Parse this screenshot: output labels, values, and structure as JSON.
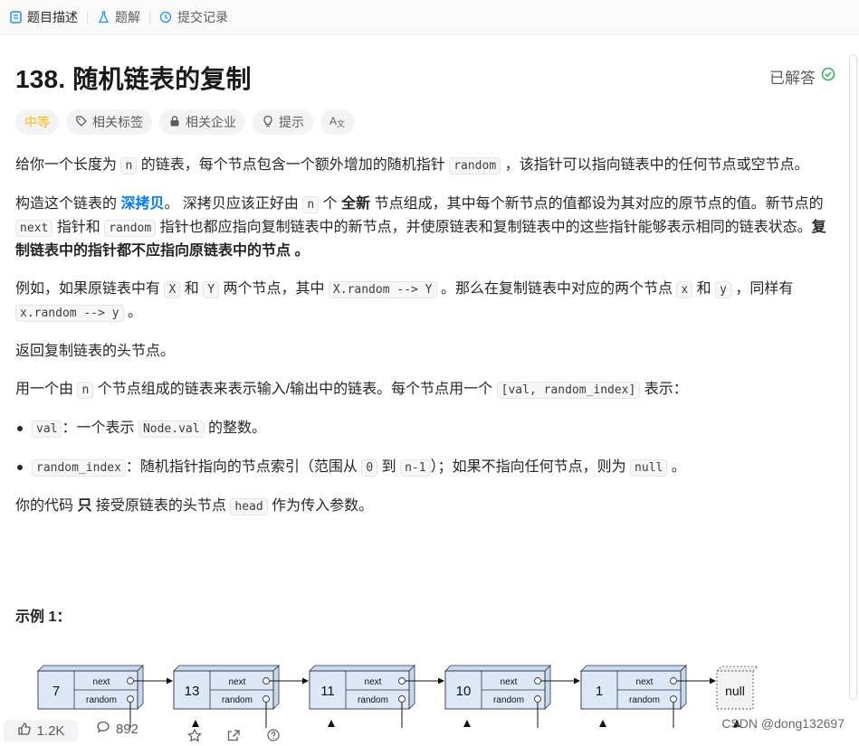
{
  "tabs": [
    {
      "label": "题目描述",
      "icon": "document-icon"
    },
    {
      "label": "题解",
      "icon": "flask-icon"
    },
    {
      "label": "提交记录",
      "icon": "clock-icon"
    }
  ],
  "problem": {
    "title": "138. 随机链表的复制",
    "status": "已解答"
  },
  "tags": {
    "difficulty": "中等",
    "related_tags": "相关标签",
    "related_companies": "相关企业",
    "hint": "提示",
    "translate": "A文"
  },
  "desc": {
    "p1_a": "给你一个长度为 ",
    "p1_code1": "n",
    "p1_b": " 的链表，每个节点包含一个额外增加的随机指针 ",
    "p1_code2": "random",
    "p1_c": " ，该指针可以指向链表中的任何节点或空节点。",
    "p2_a": "构造这个链表的 ",
    "p2_link": "深拷贝",
    "p2_b": "。 深拷贝应该正好由 ",
    "p2_code1": "n",
    "p2_c": " 个 ",
    "p2_bold1": "全新",
    "p2_d": " 节点组成，其中每个新节点的值都设为其对应的原节点的值。新节点的 ",
    "p2_code2": "next",
    "p2_e": " 指针和 ",
    "p2_code3": "random",
    "p2_f": " 指针也都应指向复制链表中的新节点，并使原链表和复制链表中的这些指针能够表示相同的链表状态。",
    "p2_bold2": "复制链表中的指针都不应指向原链表中的节点",
    "p2_g": " 。",
    "p3_a": "例如，如果原链表中有 ",
    "p3_code1": "X",
    "p3_b": " 和 ",
    "p3_code2": "Y",
    "p3_c": " 两个节点，其中 ",
    "p3_code3": "X.random --> Y",
    "p3_d": " 。那么在复制链表中对应的两个节点 ",
    "p3_code4": "x",
    "p3_e": " 和 ",
    "p3_code5": "y",
    "p3_f": " ，同样有 ",
    "p3_code6": "x.random --> y",
    "p3_g": " 。",
    "p4": "返回复制链表的头节点。",
    "p5_a": "用一个由 ",
    "p5_code1": "n",
    "p5_b": " 个节点组成的链表来表示输入/输出中的链表。每个节点用一个 ",
    "p5_code2": "[val, random_index]",
    "p5_c": " 表示：",
    "li1_code1": "val",
    "li1_a": "：一个表示 ",
    "li1_code2": "Node.val",
    "li1_b": " 的整数。",
    "li2_code1": "random_index",
    "li2_a": "：随机指针指向的节点索引（范围从 ",
    "li2_code2": "0",
    "li2_b": " 到 ",
    "li2_code3": "n-1",
    "li2_c": "）；如果不指向任何节点，则为  ",
    "li2_code4": "null",
    "li2_d": " 。",
    "p6_a": "你的代码 ",
    "p6_bold": "只",
    "p6_b": " 接受原链表的头节点 ",
    "p6_code": "head",
    "p6_c": " 作为传入参数。"
  },
  "example": {
    "title": "示例 1：",
    "nodes": [
      "7",
      "13",
      "11",
      "10",
      "1"
    ],
    "next_label": "next",
    "random_label": "random",
    "null_label": "null"
  },
  "bottom": {
    "likes": "1.2K",
    "comments": "892"
  },
  "watermark": "CSDN @dong132697"
}
